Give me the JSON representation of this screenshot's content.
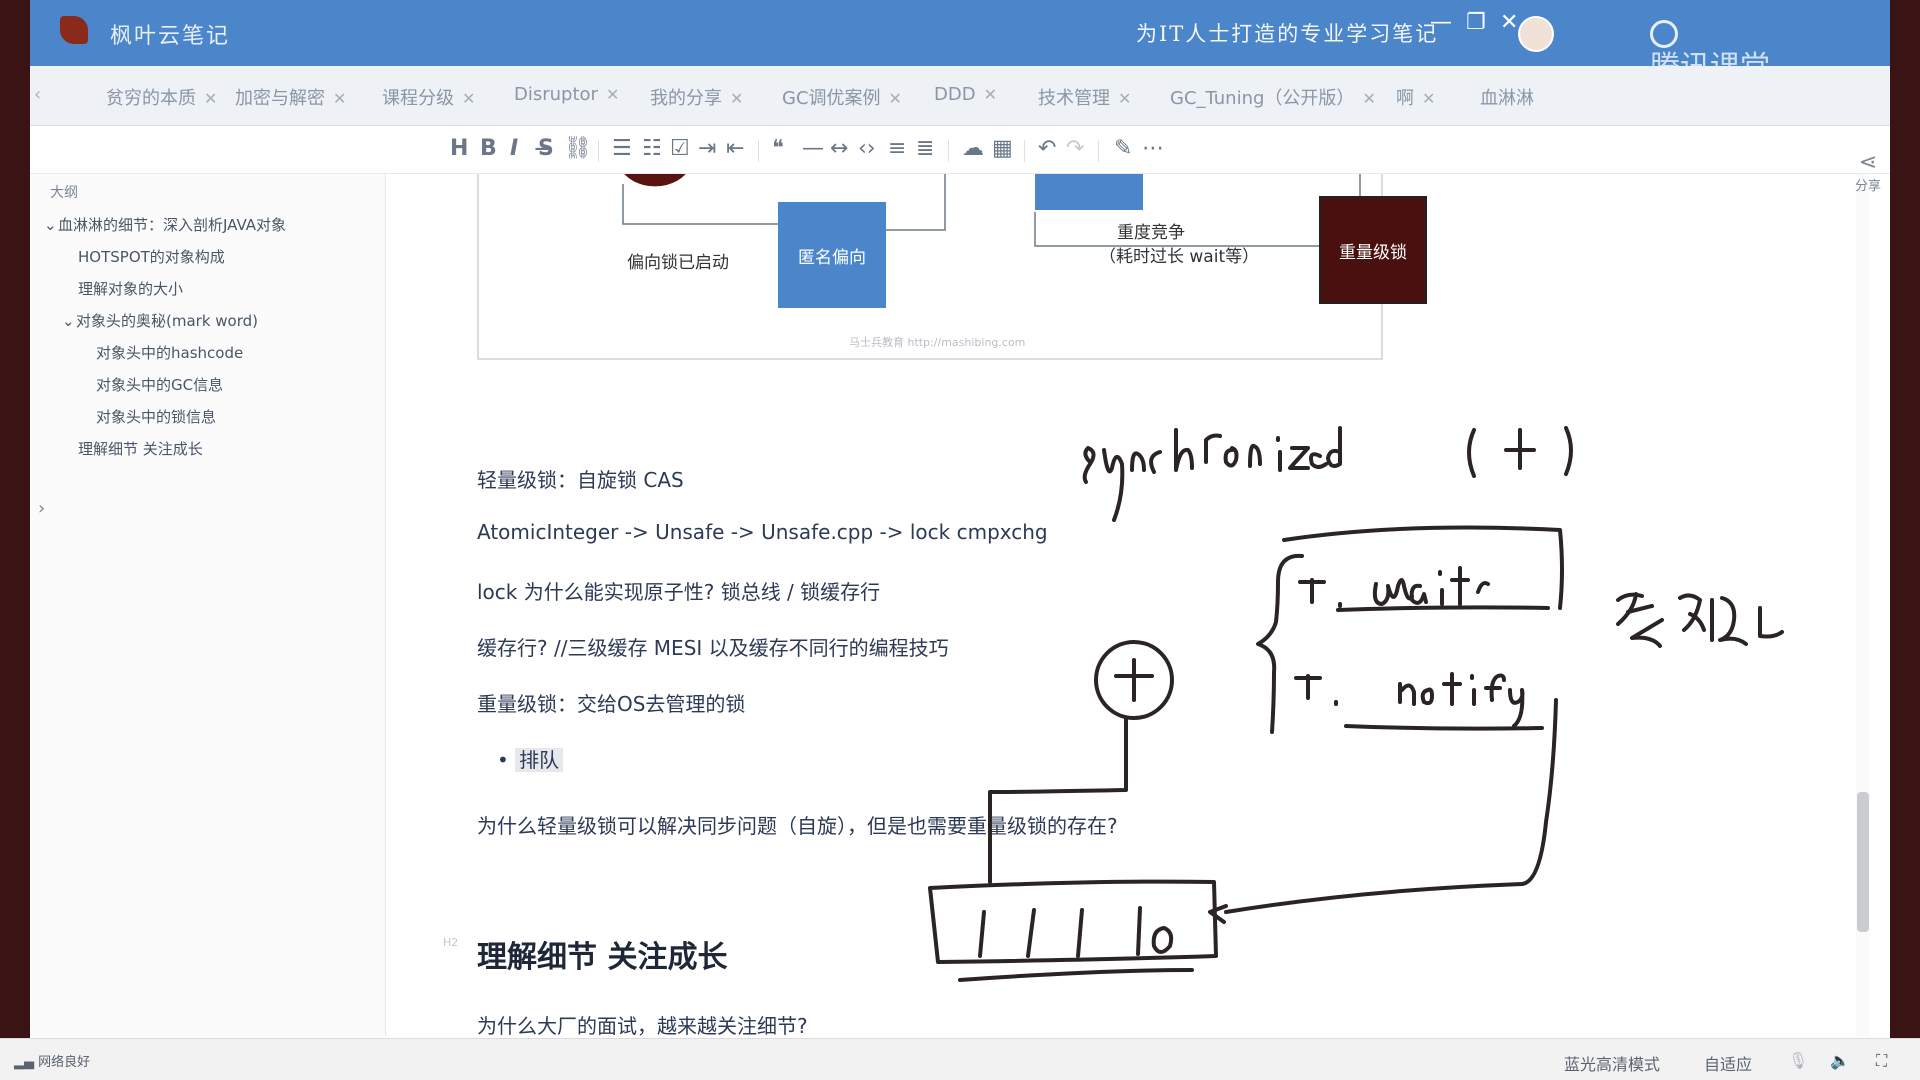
{
  "titlebar": {
    "app_name": "枫叶云笔记",
    "slogan": "为IT人士打造的专业学习笔记",
    "watermark": "腾讯课堂",
    "minimize": "—",
    "maximize": "❐",
    "close": "✕"
  },
  "tabs": [
    {
      "label": "贫穷的本质"
    },
    {
      "label": "加密与解密"
    },
    {
      "label": "课程分级"
    },
    {
      "label": "Disruptor"
    },
    {
      "label": "我的分享"
    },
    {
      "label": "GC调优案例"
    },
    {
      "label": "DDD"
    },
    {
      "label": "技术管理"
    },
    {
      "label": "GC_Tuning（公开版）"
    },
    {
      "label": "啊"
    },
    {
      "label": "血淋淋"
    }
  ],
  "toolbar": {
    "heading": "H",
    "bold": "B",
    "italic": "I",
    "strike": "S̶",
    "link": "⛓",
    "ul": "☰",
    "ol": "☷",
    "task": "☑",
    "indent": "⇥",
    "outdent": "⇤",
    "quote": "❝",
    "hr": "—",
    "arrows": "↔",
    "code": "‹›",
    "align1": "≡",
    "align2": "≣",
    "cloud": "☁",
    "table": "▦",
    "undo": "↶",
    "redo": "↷",
    "pen": "✎",
    "more": "⋯"
  },
  "outline": {
    "title": "大纲",
    "items": [
      {
        "label": "血淋淋的细节：深入剖析JAVA对象",
        "level": 0,
        "expanded": true
      },
      {
        "label": "HOTSPOT的对象构成",
        "level": 1
      },
      {
        "label": "理解对象的大小",
        "level": 1
      },
      {
        "label": "对象头的奥秘(mark word)",
        "level": 1,
        "expanded": true
      },
      {
        "label": "对象头中的hashcode",
        "level": 2
      },
      {
        "label": "对象头中的GC信息",
        "level": 2
      },
      {
        "label": "对象头中的锁信息",
        "level": 2
      },
      {
        "label": "理解细节 关注成长",
        "level": 1
      }
    ]
  },
  "diagram": {
    "anon_bias": "匿名偏向",
    "bias_started": "偏向锁已启动",
    "heavy_compete": "重度竞争",
    "heavy_compete_note": "（耗时过长 wait等）",
    "heavy_lock": "重量级锁",
    "credit": "马士兵教育 http://mashibing.com"
  },
  "content": {
    "p1": "轻量级锁：自旋锁 CAS",
    "p2": "AtomicInteger -> Unsafe -> Unsafe.cpp -> lock cmpxchg",
    "p3": "lock 为什么能实现原子性? 锁总线 / 锁缓存行",
    "p4": "缓存行? //三级缓存 MESI 以及缓存不同行的编程技巧",
    "p5": "重量级锁：交给OS去管理的锁",
    "bullet": "排队",
    "p6": "为什么轻量级锁可以解决同步问题（自旋），但是也需要重量级锁的存在?",
    "h2_tag": "H2",
    "h2": "理解细节 关注成长",
    "p7": "为什么大厂的面试，越来越关注细节?"
  },
  "share_label": "分享",
  "status": {
    "network": "网络良好",
    "mode": "蓝光高清模式",
    "fit": "自适应"
  },
  "ink_color": "#2b2424",
  "accent": "#4a86c9"
}
